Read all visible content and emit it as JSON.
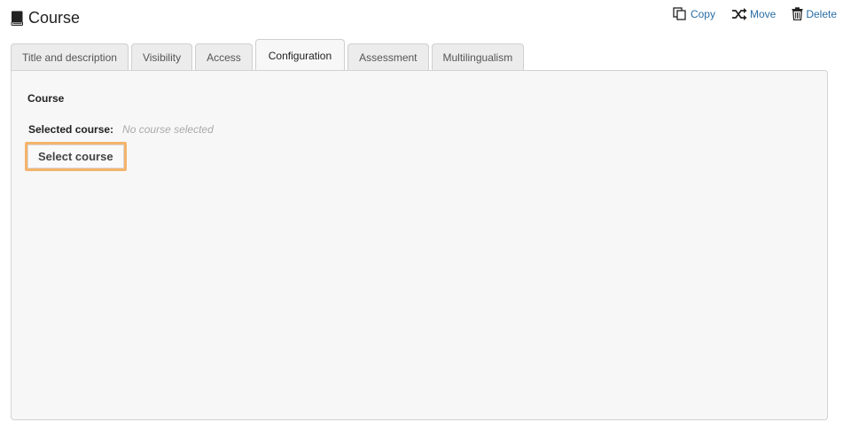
{
  "header": {
    "title": "Course",
    "icon": "book-icon"
  },
  "actions": [
    {
      "label": "Copy",
      "icon": "copy-icon"
    },
    {
      "label": "Move",
      "icon": "shuffle-icon"
    },
    {
      "label": "Delete",
      "icon": "trash-icon"
    }
  ],
  "tabs": [
    {
      "label": "Title and description",
      "active": false
    },
    {
      "label": "Visibility",
      "active": false
    },
    {
      "label": "Access",
      "active": false
    },
    {
      "label": "Configuration",
      "active": true
    },
    {
      "label": "Assessment",
      "active": false
    },
    {
      "label": "Multilingualism",
      "active": false
    }
  ],
  "panel": {
    "heading": "Course",
    "selected_label": "Selected course:",
    "selected_value": "No course selected",
    "select_button": "Select course"
  },
  "colors": {
    "link": "#2a6ea6",
    "highlight": "#f4b46b",
    "panel_bg": "#f7f7f7"
  }
}
